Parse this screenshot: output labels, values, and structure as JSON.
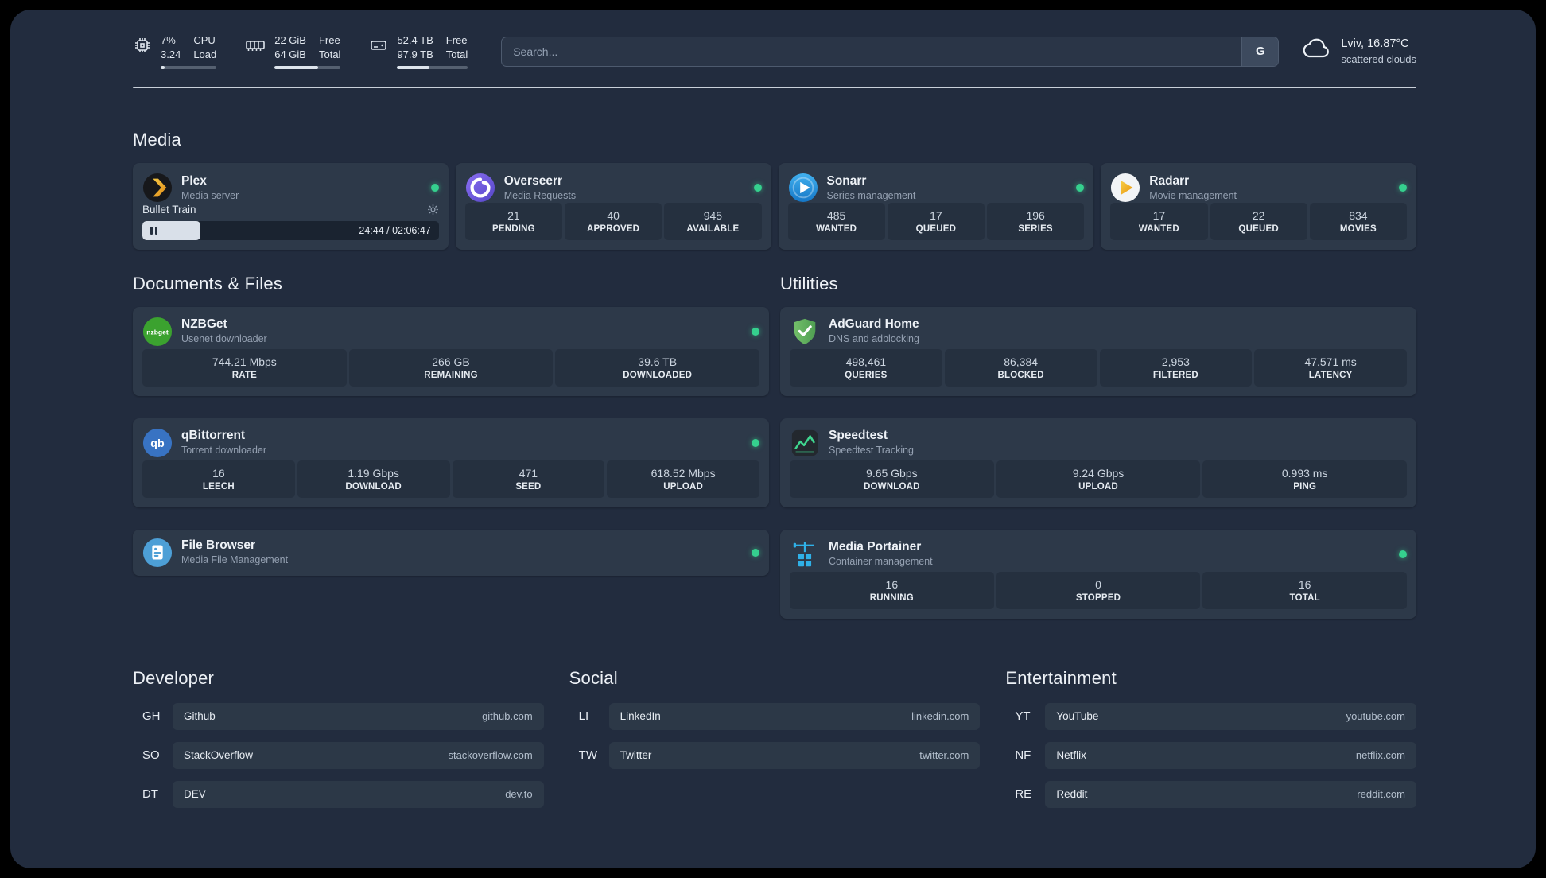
{
  "topbar": {
    "resources": [
      {
        "icon": "cpu-icon",
        "v1": "7%",
        "v2": "3.24",
        "l1": "CPU",
        "l2": "Load",
        "progress": 7
      },
      {
        "icon": "memory-icon",
        "v1": "22 GiB",
        "v2": "64 GiB",
        "l1": "Free",
        "l2": "Total",
        "progress": 66
      },
      {
        "icon": "disk-icon",
        "v1": "52.4 TB",
        "v2": "97.9 TB",
        "l1": "Free",
        "l2": "Total",
        "progress": 46
      }
    ],
    "search": {
      "placeholder": "Search...",
      "provider_label": "G"
    },
    "weather": {
      "location": "Lviv, 16.87°C",
      "condition": "scattered clouds"
    }
  },
  "media": {
    "heading": "Media",
    "cards": [
      {
        "name": "Plex",
        "desc": "Media server",
        "online": true,
        "player": {
          "title": "Bullet Train",
          "time": "24:44 / 02:06:47",
          "progress": 19.5
        }
      },
      {
        "name": "Overseerr",
        "desc": "Media Requests",
        "online": true,
        "stats": [
          {
            "value": "21",
            "label": "PENDING"
          },
          {
            "value": "40",
            "label": "APPROVED"
          },
          {
            "value": "945",
            "label": "AVAILABLE"
          }
        ]
      },
      {
        "name": "Sonarr",
        "desc": "Series management",
        "online": true,
        "stats": [
          {
            "value": "485",
            "label": "WANTED"
          },
          {
            "value": "17",
            "label": "QUEUED"
          },
          {
            "value": "196",
            "label": "SERIES"
          }
        ]
      },
      {
        "name": "Radarr",
        "desc": "Movie management",
        "online": true,
        "stats": [
          {
            "value": "17",
            "label": "WANTED"
          },
          {
            "value": "22",
            "label": "QUEUED"
          },
          {
            "value": "834",
            "label": "MOVIES"
          }
        ]
      }
    ]
  },
  "documents": {
    "heading": "Documents & Files",
    "cards": [
      {
        "name": "NZBGet",
        "desc": "Usenet downloader",
        "online": true,
        "icon_text": "nzbget",
        "stats": [
          {
            "value": "744.21 Mbps",
            "label": "RATE"
          },
          {
            "value": "266 GB",
            "label": "REMAINING"
          },
          {
            "value": "39.6 TB",
            "label": "DOWNLOADED"
          }
        ]
      },
      {
        "name": "qBittorrent",
        "desc": "Torrent downloader",
        "online": true,
        "icon_text": "qb",
        "stats": [
          {
            "value": "16",
            "label": "LEECH"
          },
          {
            "value": "1.19 Gbps",
            "label": "DOWNLOAD"
          },
          {
            "value": "471",
            "label": "SEED"
          },
          {
            "value": "618.52 Mbps",
            "label": "UPLOAD"
          }
        ]
      },
      {
        "name": "File Browser",
        "desc": "Media File Management",
        "online": true,
        "stats": []
      }
    ]
  },
  "utilities": {
    "heading": "Utilities",
    "cards": [
      {
        "name": "AdGuard Home",
        "desc": "DNS and adblocking",
        "online": false,
        "stats": [
          {
            "value": "498,461",
            "label": "QUERIES"
          },
          {
            "value": "86,384",
            "label": "BLOCKED"
          },
          {
            "value": "2,953",
            "label": "FILTERED"
          },
          {
            "value": "47.571 ms",
            "label": "LATENCY"
          }
        ]
      },
      {
        "name": "Speedtest",
        "desc": "Speedtest Tracking",
        "online": false,
        "stats": [
          {
            "value": "9.65 Gbps",
            "label": "DOWNLOAD"
          },
          {
            "value": "9.24 Gbps",
            "label": "UPLOAD"
          },
          {
            "value": "0.993 ms",
            "label": "PING"
          }
        ]
      },
      {
        "name": "Media Portainer",
        "desc": "Container management",
        "online": true,
        "stats": [
          {
            "value": "16",
            "label": "RUNNING"
          },
          {
            "value": "0",
            "label": "STOPPED"
          },
          {
            "value": "16",
            "label": "TOTAL"
          }
        ]
      }
    ]
  },
  "bookmarks": [
    {
      "heading": "Developer",
      "items": [
        {
          "abbr": "GH",
          "name": "Github",
          "url": "github.com"
        },
        {
          "abbr": "SO",
          "name": "StackOverflow",
          "url": "stackoverflow.com"
        },
        {
          "abbr": "DT",
          "name": "DEV",
          "url": "dev.to"
        }
      ]
    },
    {
      "heading": "Social",
      "items": [
        {
          "abbr": "LI",
          "name": "LinkedIn",
          "url": "linkedin.com"
        },
        {
          "abbr": "TW",
          "name": "Twitter",
          "url": "twitter.com"
        }
      ]
    },
    {
      "heading": "Entertainment",
      "items": [
        {
          "abbr": "YT",
          "name": "YouTube",
          "url": "youtube.com"
        },
        {
          "abbr": "NF",
          "name": "Netflix",
          "url": "netflix.com"
        },
        {
          "abbr": "RE",
          "name": "Reddit",
          "url": "reddit.com"
        }
      ]
    }
  ],
  "colors": {
    "online_dot": "#35d08e",
    "background": "#222c3e",
    "card": "#2d3949"
  }
}
